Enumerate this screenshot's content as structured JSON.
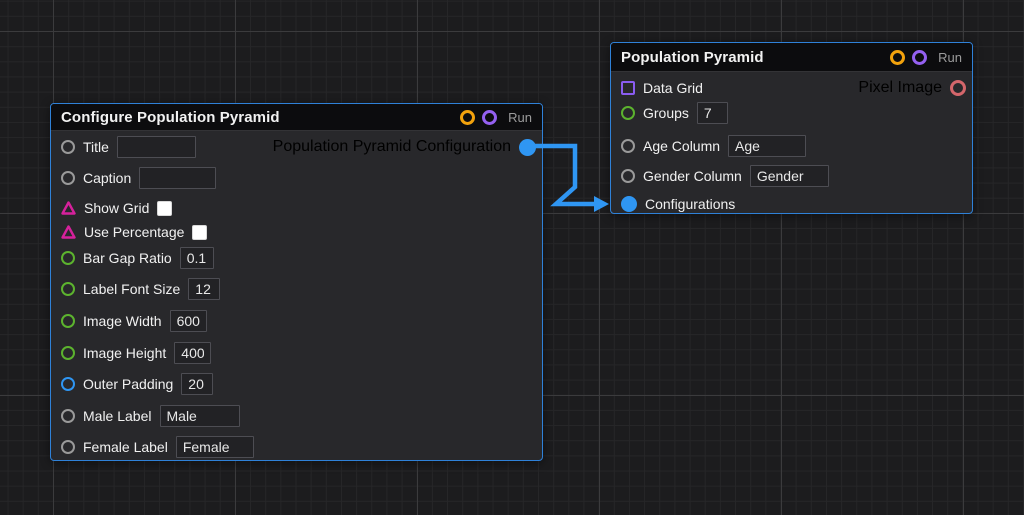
{
  "configure_node": {
    "title": "Configure Population Pyramid",
    "run_label": "Run",
    "output_label": "Population Pyramid Configuration",
    "rows": [
      {
        "label": "Title",
        "value": ""
      },
      {
        "label": "Caption",
        "value": ""
      },
      {
        "label": "Show Grid",
        "checked": false
      },
      {
        "label": "Use Percentage",
        "checked": false
      },
      {
        "label": "Bar Gap Ratio",
        "value": "0.1"
      },
      {
        "label": "Label Font Size",
        "value": "12"
      },
      {
        "label": "Image Width",
        "value": "600"
      },
      {
        "label": "Image Height",
        "value": "400"
      },
      {
        "label": "Outer Padding",
        "value": "20"
      },
      {
        "label": "Male Label",
        "value": "Male"
      },
      {
        "label": "Female Label",
        "value": "Female"
      }
    ]
  },
  "pyramid_node": {
    "title": "Population Pyramid",
    "run_label": "Run",
    "output_label": "Pixel Image",
    "rows": [
      {
        "label": "Data Grid"
      },
      {
        "label": "Groups",
        "value": "7"
      },
      {
        "label": "Age Column",
        "value": "Age"
      },
      {
        "label": "Gender Column",
        "value": "Gender"
      },
      {
        "label": "Configurations"
      }
    ]
  },
  "colors": {
    "node_border": "#2f81d8",
    "wire": "#2f96f3",
    "port_gray": "#9a9a9a",
    "port_green": "#5cb32e",
    "port_blue": "#2f96f3",
    "port_magenta": "#d6219c",
    "port_purple": "#8a5cf0",
    "port_red": "#d4666b",
    "status_orange": "#f2a20d",
    "status_purple": "#9460f0"
  }
}
